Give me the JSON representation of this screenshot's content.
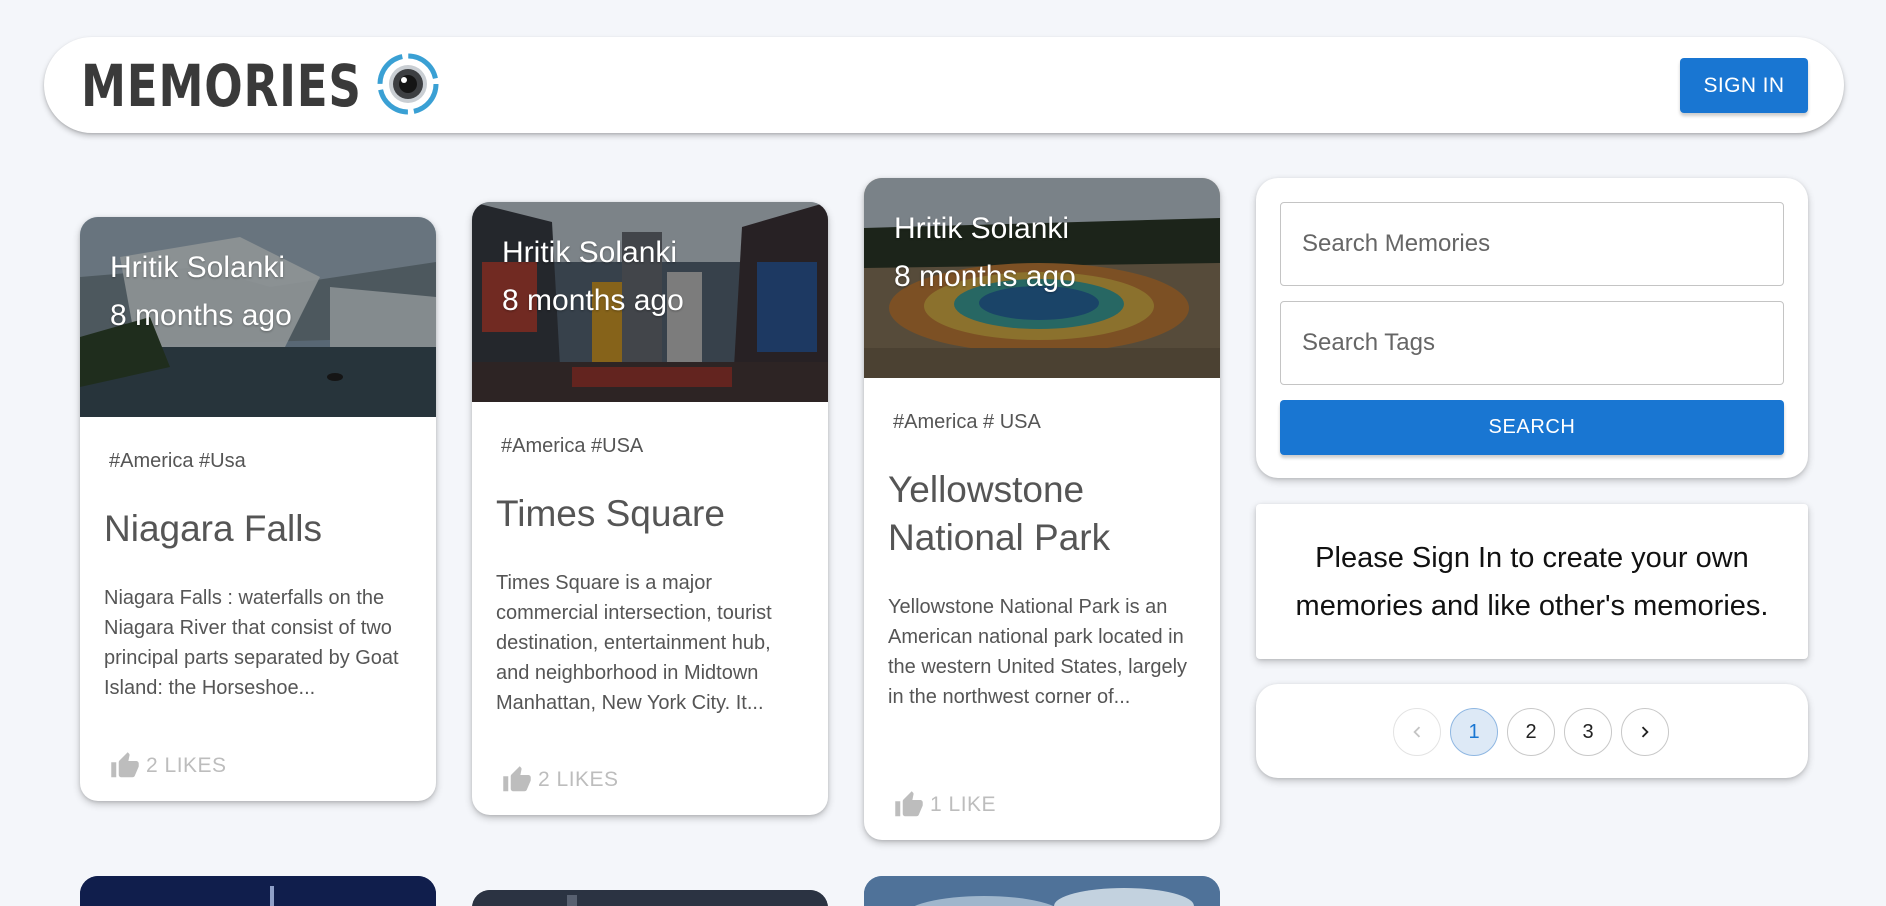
{
  "header": {
    "brand": "MEMORIES",
    "signin_label": "SIGN IN"
  },
  "cards": [
    {
      "author": "Hritik Solanki",
      "time": "8 months ago",
      "tags": "#America #Usa",
      "title": "Niagara Falls",
      "description": "Niagara Falls : waterfalls on the Niagara River that consist of two principal parts separated by Goat Island: the Horseshoe...",
      "likes": "2 LIKES"
    },
    {
      "author": "Hritik Solanki",
      "time": "8 months ago",
      "tags": "#America #USA",
      "title": "Times Square",
      "description": "Times Square is a major commercial intersection, tourist destination, entertainment hub, and neighborhood in Midtown Manhattan, New York City. It...",
      "likes": "2 LIKES"
    },
    {
      "author": "Hritik Solanki",
      "time": "8 months ago",
      "tags": "#America # USA",
      "title": "Yellowstone National Park",
      "description": "Yellowstone National Park is an American national park located in the western United States, largely in the northwest corner of...",
      "likes": "1 LIKE"
    }
  ],
  "search": {
    "memories_placeholder": "Search Memories",
    "tags_placeholder": "Search Tags",
    "button_label": "SEARCH"
  },
  "notice": {
    "text": "Please Sign In to create your own memories and like other's memories."
  },
  "pagination": {
    "pages": [
      "1",
      "2",
      "3"
    ],
    "current": "1"
  },
  "colors": {
    "primary": "#1976d2",
    "background": "#f4f6fa"
  },
  "icons": {
    "like": "thumb-up-icon",
    "prev": "chevron-left-icon",
    "next": "chevron-right-icon",
    "logo": "camera-lens-icon"
  }
}
